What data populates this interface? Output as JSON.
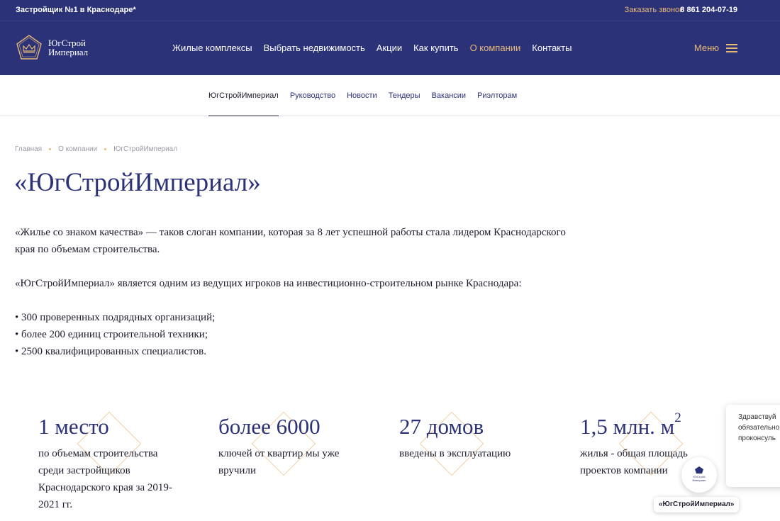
{
  "topbar": {
    "tagline": "Застройщик №1 в Краснодаре*",
    "callback_label": "Заказать звонок",
    "phone": "8 861 204-07-19"
  },
  "header": {
    "logo_line1": "ЮгСтрой",
    "logo_line2": "Империал",
    "nav": [
      {
        "label": "Жилые комплексы"
      },
      {
        "label": "Выбрать недвижимость"
      },
      {
        "label": "Акции"
      },
      {
        "label": "Как купить"
      },
      {
        "label": "О компании"
      },
      {
        "label": "Контакты"
      }
    ],
    "active_nav": "О компании",
    "menu_label": "Меню"
  },
  "subnav": {
    "items": [
      {
        "label": "ЮгСтройИмпериал"
      },
      {
        "label": "Руководство"
      },
      {
        "label": "Новости"
      },
      {
        "label": "Тендеры"
      },
      {
        "label": "Вакансии"
      },
      {
        "label": "Риэлторам"
      }
    ],
    "active": "ЮгСтройИмпериал"
  },
  "breadcrumb": [
    "Главная",
    "О компании",
    "ЮгСтройИмпериал"
  ],
  "page": {
    "title": "«ЮгСтройИмпериал»",
    "paragraph1": "«Жилье со знаком качества» — таков слоган компании, которая за 8 лет успешной работы стала лидером Краснодарского края по объемам строительства.",
    "paragraph2": "«ЮгСтройИмпериал» является одним из ведущих игроков на инвестиционно-строительном рынке Краснодара:",
    "bullets": [
      "• 300 проверенных подрядных организаций;",
      "• более 200 единиц строительной техники;",
      "• 2500 квалифицированных специалистов."
    ]
  },
  "stats": [
    {
      "value": "1 место",
      "description": "по объемам строительства среди застройщиков Краснодарского края за 2019-2021 гг."
    },
    {
      "value": "более 6000",
      "description": "ключей от квартир мы уже вручили"
    },
    {
      "value": "27 домов",
      "description": "введены в эксплуатацию"
    },
    {
      "value": "1,5 млн. м",
      "sup": "2",
      "description": "жилья - общая площадь проектов компании"
    }
  ],
  "chat": {
    "popup_lines": [
      "Здравствуй",
      "обязательно",
      "проконсуль"
    ],
    "avatar_text": "ЮгСтрой Империал",
    "label": "«ЮгСтройИмпериал»"
  },
  "colors": {
    "brand_navy": "#2b3278",
    "accent_gold": "#e8b877",
    "diamond": "#f0cfa6"
  },
  "icons": {
    "logo": "pentagon-crown-icon",
    "menu": "hamburger-icon"
  }
}
